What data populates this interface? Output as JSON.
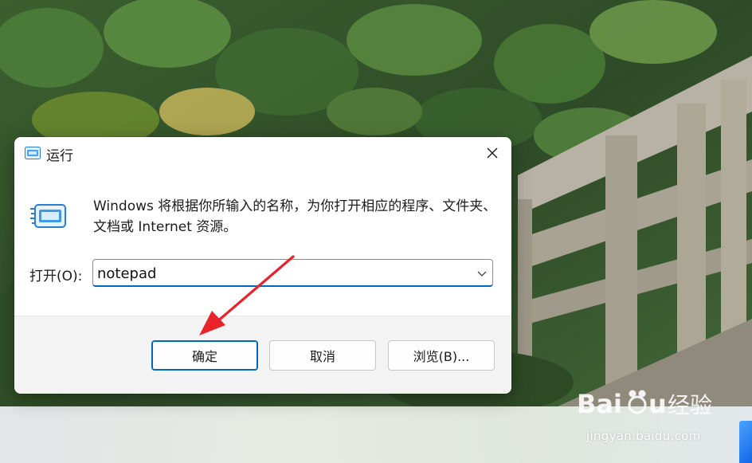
{
  "dialog": {
    "title": "运行",
    "description": "Windows 将根据你所输入的名称，为你打开相应的程序、文件夹、文档或 Internet 资源。",
    "open_label": "打开(O):",
    "input_value": "notepad",
    "buttons": {
      "ok": "确定",
      "cancel": "取消",
      "browse": "浏览(B)..."
    },
    "icons": {
      "title_icon": "run-icon",
      "close": "close-icon",
      "dropdown": "chevron-down-icon"
    }
  },
  "annotation": {
    "color": "#e8232a"
  },
  "watermark": {
    "brand": "Baidu经验",
    "url": "jingyan.baidu.com"
  },
  "colors": {
    "accent": "#0067c0",
    "dialog_bg": "#ffffff",
    "button_bar_bg": "#f3f3f3"
  }
}
